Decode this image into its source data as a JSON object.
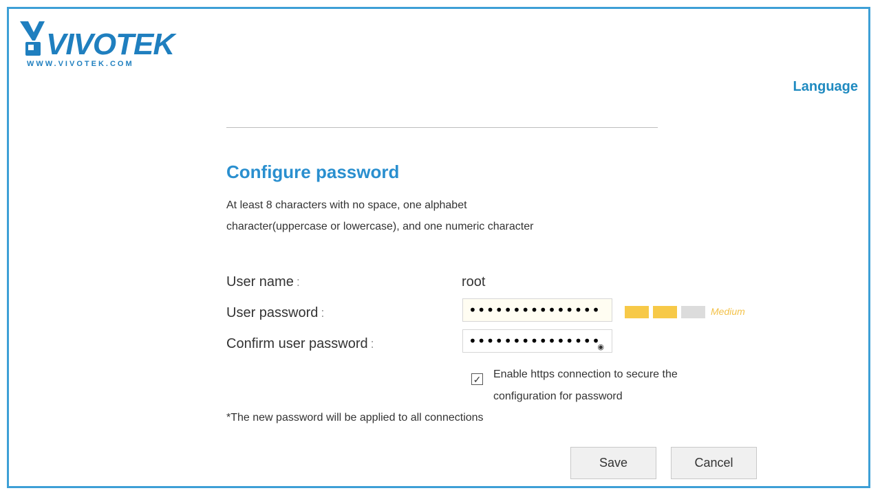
{
  "brand": {
    "name": "VIVOTEK",
    "url": "WWW.VIVOTEK.COM",
    "color": "#1f7fbf"
  },
  "header": {
    "language_link": "Language"
  },
  "form": {
    "title": "Configure password",
    "description": "At least 8 characters with no space, one alphabet character(uppercase or lowercase), and one numeric character",
    "username_label": "User name",
    "username_value": "root",
    "password_label": "User password",
    "password_value": "•••••••••••••••",
    "confirm_label": "Confirm user password",
    "confirm_value": "•••••••••••••••",
    "colon": ":",
    "strength": {
      "label": "Medium",
      "level": 2,
      "max": 3,
      "active_color": "#f7c948",
      "inactive_color": "#dcdcdc"
    },
    "https_checkbox": {
      "checked": true,
      "label": "Enable https connection to secure the configuration for password"
    },
    "note": "*The new password will be applied to all connections",
    "save_label": "Save",
    "cancel_label": "Cancel"
  },
  "colors": {
    "accent": "#2a8fcf",
    "border": "#3d9fd6"
  }
}
